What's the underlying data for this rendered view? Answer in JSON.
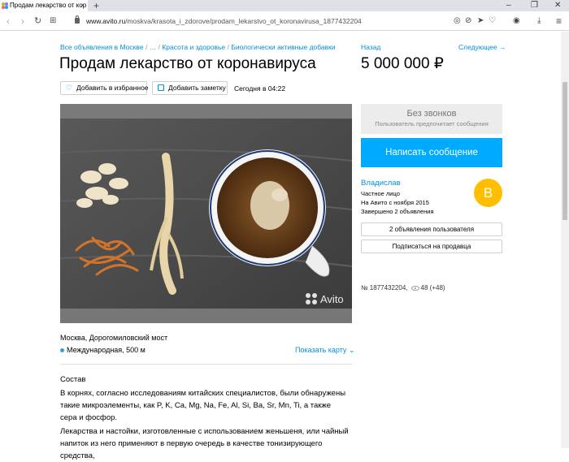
{
  "browser": {
    "tab_title": "Продам лекарство от кор",
    "tab_close": "×",
    "new_tab": "+",
    "url_host": "www.avito.ru",
    "url_path": "/moskva/krasota_i_zdorove/prodam_lekarstvo_ot_koronavirusa_1877432204",
    "nav": {
      "back": "‹",
      "forward": "›",
      "reload": "↻",
      "apps": "⊞"
    },
    "window": {
      "minimize": "–",
      "maximize": "❐",
      "close": "✕"
    },
    "menu": "≡"
  },
  "breadcrumbs": {
    "items": [
      "Все объявления в Москве",
      "…",
      "Красота и здоровье",
      "Биологически активные добавки"
    ],
    "separator": "/"
  },
  "listing": {
    "title": "Продам лекарство от коронавируса",
    "favorite_label": "Добавить в избранное",
    "note_label": "Добавить заметку",
    "date": "Сегодня в 04:22",
    "photo_watermark": "Avito",
    "location": "Москва, Дорогомиловский мост",
    "metro": "Международная, 500 м",
    "map_link": "Показать карту",
    "description_heading": "Состав",
    "description_p1": "В корнях, согласно исследованиям китайских специалистов, были обнаружены такие микроэлементы, как P, K, Ca, Mg, Na, Fe, Al, Si, Ba, Sr, Mn, Ti, а также сера и фосфор.",
    "description_p2": "Лекарства и настойки, изготовленные с использованием женьшеня, или чайный напиток из него применяют в первую очередь в качестве тонизирующего средства,"
  },
  "sidebar": {
    "back": "Назад",
    "next": "Следующее →",
    "price": "5 000 000 ₽",
    "no_calls_title": "Без звонков",
    "no_calls_sub": "Пользователь предпочитает сообщения",
    "write_button": "Написать сообщение",
    "seller_name": "Владислав",
    "seller_type": "Частное лицо",
    "seller_since": "На Авито с ноября 2015",
    "seller_completed": "Завершено 2 объявления",
    "avatar_letter": "В",
    "user_ads_button": "2 объявления пользователя",
    "subscribe_button": "Подписаться на продавца",
    "ad_id": "№ 1877432204,",
    "views": "48 (+48)"
  },
  "colors": {
    "link": "#0091d9",
    "primary": "#00aaff",
    "avatar": "#ffbf00"
  }
}
